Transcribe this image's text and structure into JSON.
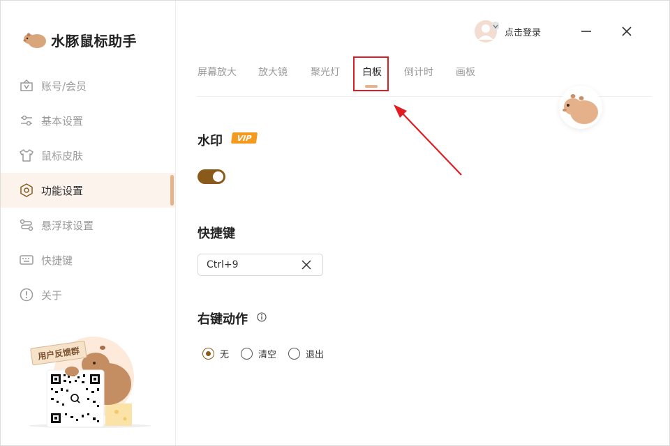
{
  "app": {
    "title": "水豚鼠标助手"
  },
  "sidebar": {
    "items": [
      {
        "label": "账号/会员",
        "icon": "vip-account-icon"
      },
      {
        "label": "基本设置",
        "icon": "sliders-icon"
      },
      {
        "label": "鼠标皮肤",
        "icon": "tshirt-icon"
      },
      {
        "label": "功能设置",
        "icon": "hexagon-settings-icon",
        "active": true
      },
      {
        "label": "悬浮球设置",
        "icon": "floating-ball-icon"
      },
      {
        "label": "快捷键",
        "icon": "keyboard-icon"
      },
      {
        "label": "关于",
        "icon": "info-circle-icon"
      }
    ],
    "feedback": {
      "sign_text": "用户反馈群"
    }
  },
  "header": {
    "login_label": "点击登录"
  },
  "tabs": [
    {
      "label": "屏幕放大"
    },
    {
      "label": "放大镜"
    },
    {
      "label": "聚光灯"
    },
    {
      "label": "白板",
      "active": true
    },
    {
      "label": "倒计时"
    },
    {
      "label": "画板"
    }
  ],
  "watermark": {
    "title": "水印",
    "badge": "VIP",
    "enabled": true
  },
  "shortcut": {
    "title": "快捷键",
    "value": "Ctrl+9"
  },
  "right_click": {
    "title": "右键动作",
    "options": [
      {
        "label": "无",
        "checked": true
      },
      {
        "label": "清空",
        "checked": false
      },
      {
        "label": "退出",
        "checked": false
      }
    ]
  },
  "colors": {
    "accent": "#8a5a1a",
    "indicator": "#e6b48c",
    "active_bg": "#fbf3ec",
    "vip": "#f39a1f",
    "annotation": "#e01c23"
  }
}
